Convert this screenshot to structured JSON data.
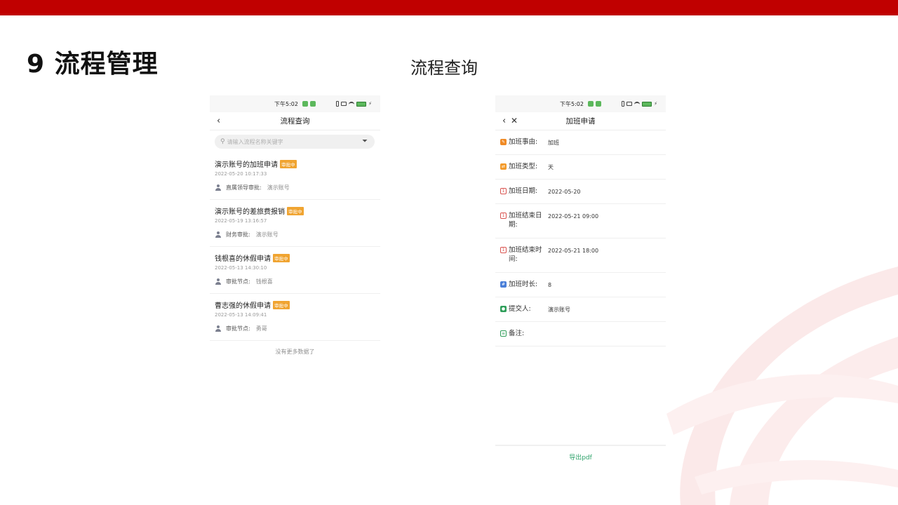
{
  "slide": {
    "title": "9 流程管理",
    "subtitle": "流程查询",
    "accent_color": "#c00000"
  },
  "list_screen": {
    "status_time": "下午5:02",
    "nav_title": "流程查询",
    "search_placeholder": "请输入流程名称关键字",
    "items": [
      {
        "title": "演示账号的加班申请",
        "badge": "审批中",
        "time": "2022-05-20 10:17:33",
        "meta_label": "直属领导审批:",
        "meta_value": "演示账号"
      },
      {
        "title": "演示账号的差旅费报销",
        "badge": "审批中",
        "time": "2022-05-19 13:16:57",
        "meta_label": "财务审批:",
        "meta_value": "演示账号"
      },
      {
        "title": "钱根喜的休假申请",
        "badge": "审批中",
        "time": "2022-05-13 14:30:10",
        "meta_label": "审批节点:",
        "meta_value": "钱根喜"
      },
      {
        "title": "曹志强的休假申请",
        "badge": "审批中",
        "time": "2022-05-13 14:09:41",
        "meta_label": "审批节点:",
        "meta_value": "勇哥"
      }
    ],
    "no_more": "没有更多数据了",
    "badge_color": "#f0a431"
  },
  "detail_screen": {
    "status_time": "下午5:02",
    "nav_title": "加班申请",
    "rows": [
      {
        "label": "加班事由:",
        "value": "加班",
        "icon": "reason-icon"
      },
      {
        "label": "加班类型:",
        "value": "天",
        "icon": "type-icon"
      },
      {
        "label": "加班日期:",
        "value": "2022-05-20",
        "icon": "calendar-icon"
      },
      {
        "label": "加班结束日期:",
        "value": "2022-05-21 09:00",
        "icon": "calendar-icon"
      },
      {
        "label": "加班结束时间:",
        "value": "2022-05-21 18:00",
        "icon": "calendar-icon"
      },
      {
        "label": "加班时长:",
        "value": "8",
        "icon": "hash-icon"
      },
      {
        "label": "提交人:",
        "value": "演示账号",
        "icon": "user-icon"
      },
      {
        "label": "备注:",
        "value": "",
        "icon": "note-icon"
      }
    ],
    "export_label": "导出pdf",
    "export_color": "#2fa36b"
  }
}
